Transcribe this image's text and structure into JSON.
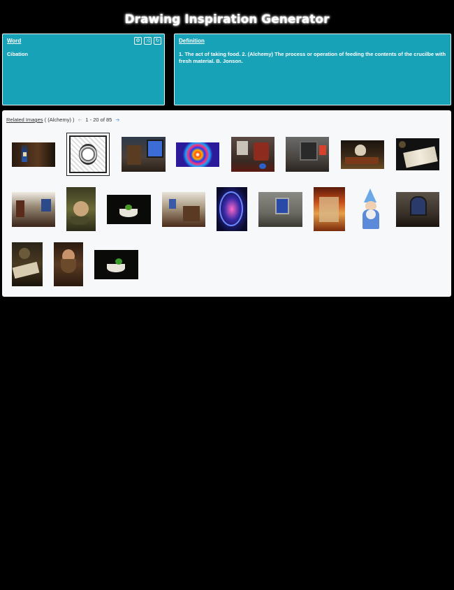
{
  "app": {
    "title": "Drawing Inspiration Generator"
  },
  "word": {
    "heading": "Word",
    "value": "Cibation",
    "controls": [
      {
        "icon": "gear-icon",
        "glyph": "⚙"
      },
      {
        "icon": "shuffle-icon",
        "glyph": "⤨"
      },
      {
        "icon": "refresh-icon",
        "glyph": "↻"
      }
    ]
  },
  "definition": {
    "heading": "Definition",
    "text": "1. The act of taking food. 2. (Alchemy) The process or operation of feeding the contents of the crucilbe with fresh material. B. Jonson."
  },
  "images": {
    "heading": "Related Images",
    "filter": "( (Alchemy) )",
    "prev_icon": "arrow-left-icon",
    "next_icon": "arrow-right-icon",
    "range": "1 - 20 of 85",
    "colors": {
      "panel": "#17a2b8",
      "link": "#1a6fd6"
    },
    "items": [
      {
        "name": "potion-bottle-image"
      },
      {
        "name": "occult-card-image"
      },
      {
        "name": "alchemist-lab-window-image"
      },
      {
        "name": "mandala-pattern-image"
      },
      {
        "name": "alchemist-room-image"
      },
      {
        "name": "stone-hall-image"
      },
      {
        "name": "skull-books-image"
      },
      {
        "name": "open-book-image"
      },
      {
        "name": "library-room-image"
      },
      {
        "name": "hands-mortar-image"
      },
      {
        "name": "mortar-herbs-image"
      },
      {
        "name": "workshop-room-image"
      },
      {
        "name": "wizard-orb-image"
      },
      {
        "name": "stone-room-window-image"
      },
      {
        "name": "burning-parchment-image"
      },
      {
        "name": "cartoon-wizard-image"
      },
      {
        "name": "gothic-room-image"
      },
      {
        "name": "alchemy-book-mortar-image"
      },
      {
        "name": "bearded-alchemist-image"
      },
      {
        "name": "mortar-leaves-image"
      }
    ]
  }
}
